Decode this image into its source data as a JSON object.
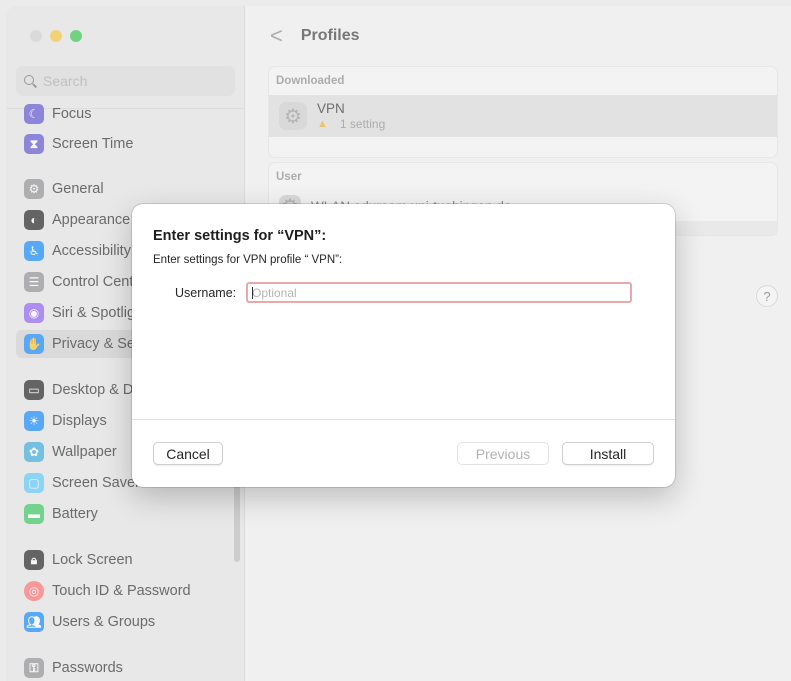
{
  "search": {
    "placeholder": "Search"
  },
  "sidebar": {
    "items": [
      {
        "label": "Focus",
        "icon": "moon-icon",
        "color": "#5a4fcf"
      },
      {
        "label": "Screen Time",
        "icon": "hourglass-icon",
        "color": "#5a4fcf"
      },
      {
        "label": "General",
        "icon": "gear-icon",
        "color": "#8e8e93"
      },
      {
        "label": "Appearance",
        "icon": "appearance-icon",
        "color": "#1c1c1e"
      },
      {
        "label": "Accessibility",
        "icon": "accessibility-icon",
        "color": "#0a84ff"
      },
      {
        "label": "Control Centre",
        "icon": "control-centre-icon",
        "color": "#8e8e93"
      },
      {
        "label": "Siri & Spotlight",
        "icon": "siri-icon",
        "color": "#8a5cf5"
      },
      {
        "label": "Privacy & Security",
        "icon": "hand-icon",
        "color": "#0a84ff"
      },
      {
        "label": "Desktop & Dock",
        "icon": "dock-icon",
        "color": "#1c1c1e"
      },
      {
        "label": "Displays",
        "icon": "sun-icon",
        "color": "#0a84ff"
      },
      {
        "label": "Wallpaper",
        "icon": "flower-icon",
        "color": "#34aadc"
      },
      {
        "label": "Screen Saver",
        "icon": "screen-saver-icon",
        "color": "#5ac8fa"
      },
      {
        "label": "Battery",
        "icon": "battery-icon",
        "color": "#34c759"
      },
      {
        "label": "Lock Screen",
        "icon": "lock-icon",
        "color": "#1c1c1e"
      },
      {
        "label": "Touch ID & Password",
        "icon": "fingerprint-icon",
        "color": "#ff6b6b"
      },
      {
        "label": "Users & Groups",
        "icon": "users-icon",
        "color": "#0a84ff"
      },
      {
        "label": "Passwords",
        "icon": "key-icon",
        "color": "#8e8e93"
      }
    ]
  },
  "main": {
    "back_glyph": "<",
    "title": "Profiles",
    "downloaded_label": "Downloaded",
    "profile_name": "VPN",
    "profile_sub": "1 setting",
    "user_label": "User",
    "user_profile": "WLAN eduroam uni-tuebingen.de",
    "help": "?"
  },
  "dialog": {
    "title": "Enter settings for “VPN”:",
    "message": "Enter settings for VPN profile “ VPN”:",
    "username_label": "Username:",
    "username_placeholder": "Optional",
    "username_value": "",
    "cancel": "Cancel",
    "previous": "Previous",
    "install": "Install"
  }
}
